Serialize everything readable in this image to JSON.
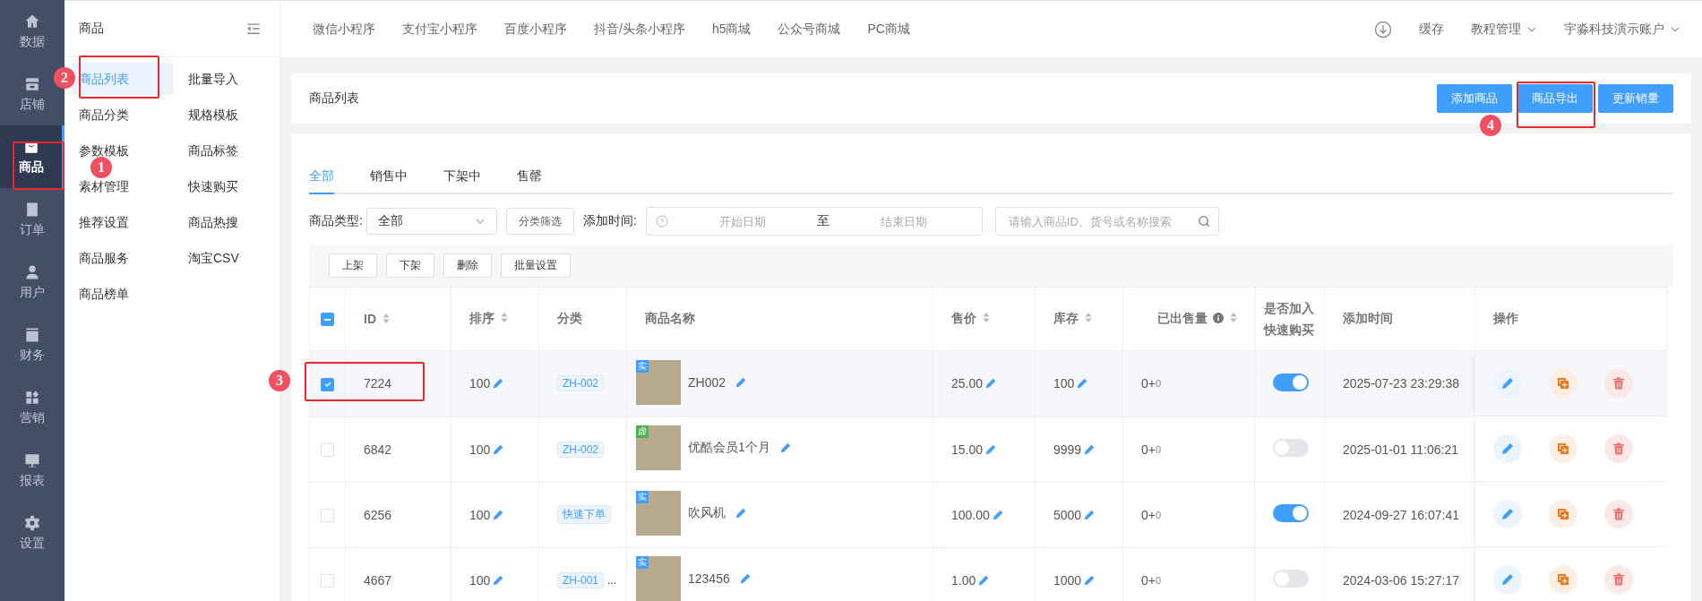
{
  "sidebar": {
    "items": [
      {
        "label": "数据",
        "selected": false
      },
      {
        "label": "店铺",
        "selected": false
      },
      {
        "label": "商品",
        "selected": true
      },
      {
        "label": "订单",
        "selected": false
      },
      {
        "label": "用户",
        "selected": false
      },
      {
        "label": "财务",
        "selected": false
      },
      {
        "label": "营销",
        "selected": false
      },
      {
        "label": "报表",
        "selected": false
      },
      {
        "label": "设置",
        "selected": false
      }
    ]
  },
  "submenu": {
    "title": "商品",
    "items": [
      {
        "label": "商品列表",
        "selected": true
      },
      {
        "label": "批量导入",
        "selected": false
      },
      {
        "label": "商品分类",
        "selected": false
      },
      {
        "label": "规格模板",
        "selected": false
      },
      {
        "label": "参数模板",
        "selected": false
      },
      {
        "label": "商品标签",
        "selected": false
      },
      {
        "label": "素材管理",
        "selected": false
      },
      {
        "label": "快速购买",
        "selected": false
      },
      {
        "label": "推荐设置",
        "selected": false
      },
      {
        "label": "商品热搜",
        "selected": false
      },
      {
        "label": "商品服务",
        "selected": false
      },
      {
        "label": "淘宝CSV",
        "selected": false
      },
      {
        "label": "商品榜单",
        "selected": false
      }
    ]
  },
  "topbar": {
    "links": [
      "微信小程序",
      "支付宝小程序",
      "百度小程序",
      "抖音/头条小程序",
      "h5商城",
      "公众号商城",
      "PC商城"
    ],
    "cache": "缓存",
    "menus": [
      "教程管理",
      "宇淼科技演示账户"
    ]
  },
  "page": {
    "title": "商品列表",
    "buttons": [
      "添加商品",
      "商品导出",
      "更新销量"
    ]
  },
  "tabs": [
    {
      "label": "全部",
      "selected": true
    },
    {
      "label": "销售中",
      "selected": false
    },
    {
      "label": "下架中",
      "selected": false
    },
    {
      "label": "售罄",
      "selected": false
    }
  ],
  "filters": {
    "type_label": "商品类型:",
    "type_value": "全部",
    "category_button": "分类筛选",
    "time_label": "添加时间:",
    "start_placeholder": "开始日期",
    "separator": "至",
    "end_placeholder": "结束日期",
    "search_placeholder": "请输入商品ID、货号或名称搜索"
  },
  "bulk_buttons": [
    "上架",
    "下架",
    "删除",
    "批量设置"
  ],
  "table": {
    "select_all_indeterminate": true,
    "columns": [
      {
        "label": "ID",
        "sortable": true
      },
      {
        "label": "排序",
        "sortable": true
      },
      {
        "label": "分类",
        "sortable": false
      },
      {
        "label": "商品名称",
        "sortable": false
      },
      {
        "label": "售价",
        "sortable": true
      },
      {
        "label": "库存",
        "sortable": true
      },
      {
        "label": "已出售量",
        "sortable": true
      },
      {
        "label": "是否加入快速购买",
        "sortable": false
      },
      {
        "label": "添加时间",
        "sortable": false
      },
      {
        "label": "操作",
        "sortable": false
      }
    ],
    "rows": [
      {
        "selected": true,
        "id": "7224",
        "sort": "100",
        "category": "ZH-002",
        "more": "",
        "badge": {
          "label": "实",
          "color": "#409eff"
        },
        "name": "ZH002",
        "price": "25.00",
        "stock": "100",
        "sold": "0+",
        "sold_extra": "0",
        "quick": true,
        "time": "2025-07-23 23:29:38"
      },
      {
        "selected": false,
        "id": "6842",
        "sort": "100",
        "category": "ZH-002",
        "more": "",
        "badge": {
          "label": "虚",
          "color": "#4caf50"
        },
        "name": "优酷会员1个月",
        "price": "15.00",
        "stock": "9999",
        "sold": "0+",
        "sold_extra": "0",
        "quick": false,
        "time": "2025-01-01 11:06:21"
      },
      {
        "selected": false,
        "id": "6256",
        "sort": "100",
        "category": "快速下单",
        "more": "",
        "badge": {
          "label": "实",
          "color": "#409eff"
        },
        "name": "吹风机",
        "price": "100.00",
        "stock": "5000",
        "sold": "0+",
        "sold_extra": "0",
        "quick": true,
        "time": "2024-09-27 16:07:41"
      },
      {
        "selected": false,
        "id": "4667",
        "sort": "100",
        "category": "ZH-001",
        "more": "...",
        "badge": {
          "label": "实",
          "color": "#409eff"
        },
        "name": "123456",
        "price": "1.00",
        "stock": "1000",
        "sold": "0+",
        "sold_extra": "0",
        "quick": false,
        "time": "2024-03-06 15:27:17"
      }
    ]
  },
  "annotations": [
    "1",
    "2",
    "3",
    "4"
  ]
}
